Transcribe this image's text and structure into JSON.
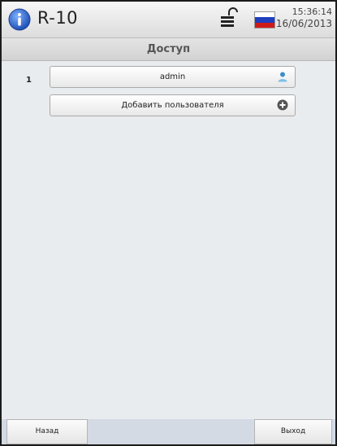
{
  "header": {
    "device_name": "R-10",
    "time": "15:36:14",
    "date": "16/06/2013",
    "icons": [
      "info-icon",
      "lock-open-icon",
      "russian-flag-icon"
    ],
    "flag_colors": [
      "#ffffff",
      "#1f3fbf",
      "#d01a1a"
    ]
  },
  "page": {
    "title": "Доступ"
  },
  "users": [
    {
      "index": "1",
      "name": "admin",
      "icon": "user-icon"
    }
  ],
  "add_user": {
    "label": "Добавить пользователя",
    "icon": "plus-circle-icon"
  },
  "footer": {
    "back_label": "Назад",
    "exit_label": "Выход"
  }
}
